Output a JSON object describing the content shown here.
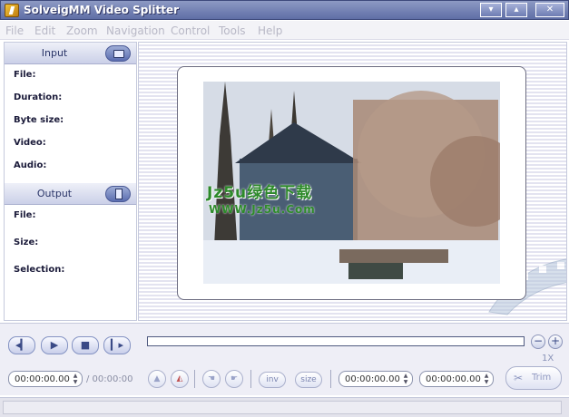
{
  "window": {
    "title": "SolveigMM Video Splitter",
    "controls": {
      "minimize": "▾",
      "maximize": "▴",
      "close": "✕"
    }
  },
  "menu": [
    "File",
    "Edit",
    "Zoom",
    "Navigation",
    "Control",
    "Tools",
    "Help"
  ],
  "input_section": {
    "header": "Input",
    "icon": "open-folder-icon",
    "fields": [
      "File:",
      "Duration:",
      "Byte size:",
      "Video:",
      "Audio:"
    ]
  },
  "output_section": {
    "header": "Output",
    "icon": "output-document-icon",
    "fields": [
      "File:",
      "Size:",
      "Selection:"
    ]
  },
  "video": {
    "watermark_line1": "Jz5u绿色下载",
    "watermark_line2": "WWW.Jz5u.Com"
  },
  "playback": {
    "buttons": [
      "previous-frame-icon",
      "play-icon",
      "stop-icon",
      "next-frame-icon"
    ],
    "current_time": "00:00:00.00",
    "total_time": "/ 00:00:00"
  },
  "timeline": {
    "zoom_level": "1X",
    "zoom_out": "−",
    "zoom_in": "+"
  },
  "edit_controls": {
    "inv_label": "inv",
    "size_label": "size",
    "start_time": "00:00:00.00",
    "end_time": "00:00:00.00",
    "trim_label": "Trim"
  },
  "colors": {
    "titlebar": "#6e7cb3",
    "accent": "#5b6db0",
    "watermark": "#2d8a2a"
  }
}
